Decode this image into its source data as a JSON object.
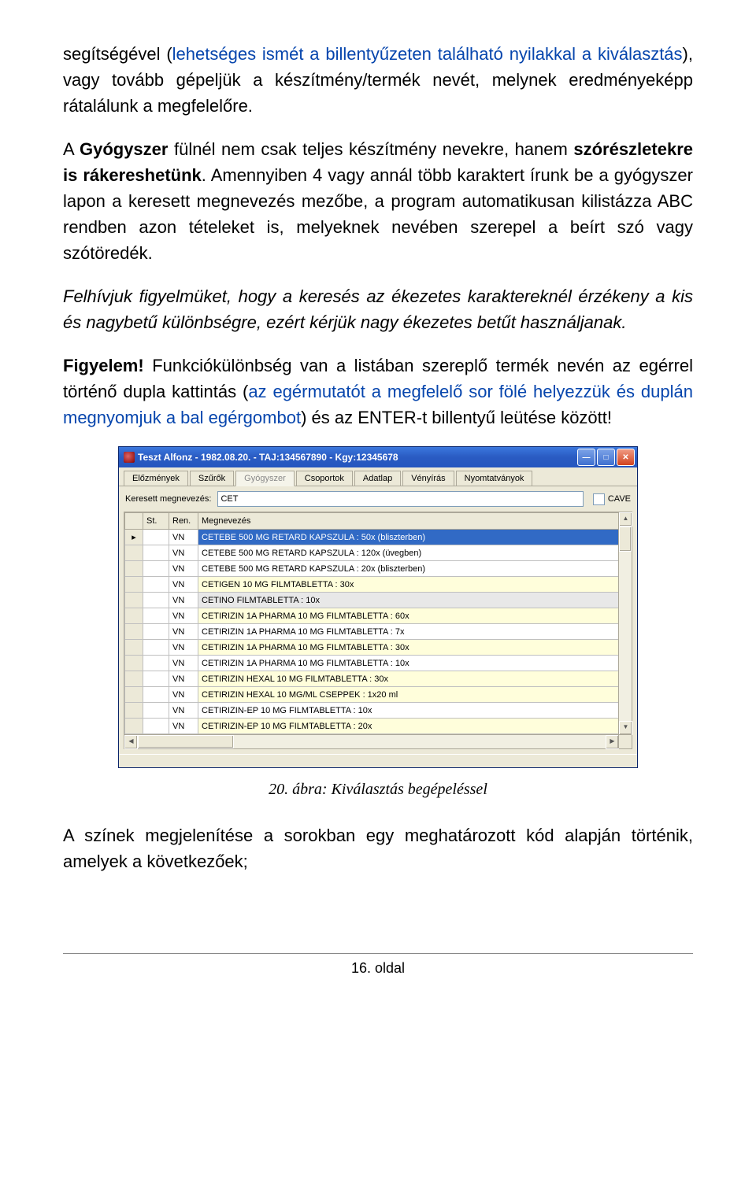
{
  "paragraphs": {
    "p1_part1": "segítségével (",
    "p1_link1": "lehetséges ismét a billentyűzeten található nyilakkal a kiválasztás",
    "p1_part2": "), vagy tovább gépeljük a készítmény/termék nevét, melynek eredményeképp rátalálunk a megfelelőre.",
    "p2_part1": "A ",
    "p2_bold1": "Gyógyszer",
    "p2_part2": " fülnél nem csak teljes készítmény nevekre, hanem ",
    "p2_bold2": "szórészletekre is rákereshetünk",
    "p2_part3": ". Amennyiben 4 vagy annál több karaktert írunk be a gyógyszer lapon a keresett megnevezés mezőbe, a program automatikusan kilistázza ABC rendben azon tételeket is, melyeknek nevében szerepel a beírt szó vagy szótöredék.",
    "p3": "Felhívjuk figyelmüket, hogy a keresés az ékezetes karaktereknél érzékeny a kis és nagybetű különbségre, ezért kérjük nagy ékezetes betűt használjanak.",
    "p4_bold": "Figyelem!",
    "p4_part1": " Funkciókülönbség van a listában szereplő termék nevén az egérrel történő dupla kattintás (",
    "p4_link": "az egérmutatót a megfelelő sor fölé helyezzük és duplán megnyomjuk a bal egérgombot",
    "p4_part2": ") és az ENTER-t billentyű leütése között!",
    "p5": "A színek megjelenítése a sorokban egy meghatározott kód alapján történik, amelyek a következőek;"
  },
  "caption": "20. ábra: Kiválasztás begépeléssel",
  "footer": "16. oldal",
  "window": {
    "title": "Teszt Alfonz - 1982.08.20. - TAJ:134567890 - Kgy:12345678",
    "tabs": [
      "Előzmények",
      "Szűrők",
      "Gyógyszer",
      "Csoportok",
      "Adatlap",
      "Vényírás",
      "Nyomtatványok"
    ],
    "active_tab_index": 2,
    "search_label": "Keresett megnevezés:",
    "search_value": "CET",
    "cave_label": "CAVE",
    "columns": [
      "St.",
      "Ren.",
      "Megnevezés"
    ],
    "rows": [
      {
        "ren": "VN",
        "name": "CETEBE 500 MG RETARD KAPSZULA : 50x (bliszterben)",
        "cls": "row-blue",
        "marker": "▸"
      },
      {
        "ren": "VN",
        "name": "CETEBE 500 MG RETARD KAPSZULA : 120x (üvegben)",
        "cls": "row-white",
        "marker": ""
      },
      {
        "ren": "VN",
        "name": "CETEBE 500 MG RETARD KAPSZULA : 20x (bliszterben)",
        "cls": "row-white",
        "marker": ""
      },
      {
        "ren": "VN",
        "name": "CETIGEN 10 MG FILMTABLETTA : 30x",
        "cls": "row-yellow",
        "marker": ""
      },
      {
        "ren": "VN",
        "name": "CETINO FILMTABLETTA : 10x",
        "cls": "row-gray",
        "marker": ""
      },
      {
        "ren": "VN",
        "name": "CETIRIZIN 1A PHARMA 10 MG FILMTABLETTA : 60x",
        "cls": "row-yellow",
        "marker": ""
      },
      {
        "ren": "VN",
        "name": "CETIRIZIN 1A PHARMA 10 MG FILMTABLETTA : 7x",
        "cls": "row-white",
        "marker": ""
      },
      {
        "ren": "VN",
        "name": "CETIRIZIN 1A PHARMA 10 MG FILMTABLETTA : 30x",
        "cls": "row-yellow",
        "marker": ""
      },
      {
        "ren": "VN",
        "name": "CETIRIZIN 1A PHARMA 10 MG FILMTABLETTA : 10x",
        "cls": "row-white",
        "marker": ""
      },
      {
        "ren": "VN",
        "name": "CETIRIZIN HEXAL 10 MG FILMTABLETTA : 30x",
        "cls": "row-yellow",
        "marker": ""
      },
      {
        "ren": "VN",
        "name": "CETIRIZIN HEXAL 10 MG/ML CSEPPEK : 1x20 ml",
        "cls": "row-yellow",
        "marker": ""
      },
      {
        "ren": "VN",
        "name": "CETIRIZIN-EP 10 MG FILMTABLETTA : 10x",
        "cls": "row-white",
        "marker": ""
      },
      {
        "ren": "VN",
        "name": "CETIRIZIN-EP 10 MG FILMTABLETTA : 20x",
        "cls": "row-yellow",
        "marker": ""
      }
    ]
  },
  "glyphs": {
    "min": "—",
    "max": "□",
    "close": "✕",
    "up": "▲",
    "down": "▼",
    "left": "◀",
    "right": "▶"
  }
}
